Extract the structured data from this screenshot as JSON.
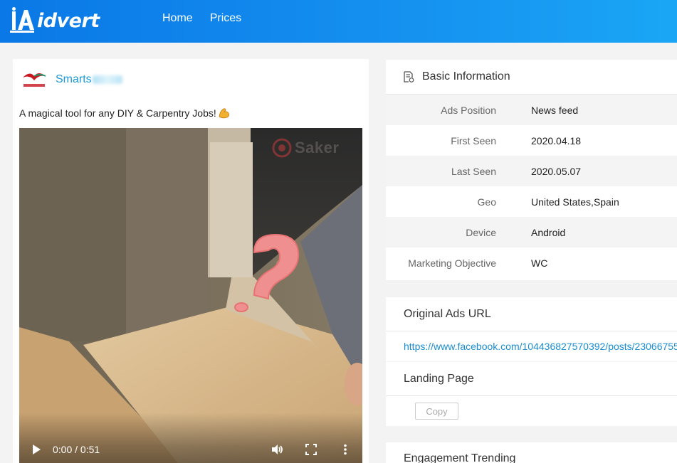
{
  "header": {
    "logo_text": "idvert",
    "nav": [
      {
        "label": "Home"
      },
      {
        "label": "Prices"
      }
    ]
  },
  "ad": {
    "advertiser_name": "Smarts",
    "text": "A magical tool for any DIY & Carpentry Jobs!",
    "watermark": "Saker",
    "video": {
      "time": "0:00 / 0:51",
      "progress": 0
    }
  },
  "basic_info": {
    "title": "Basic Information",
    "rows": [
      {
        "label": "Ads Position",
        "value": "News feed"
      },
      {
        "label": "First Seen",
        "value": "2020.04.18"
      },
      {
        "label": "Last Seen",
        "value": "2020.05.07"
      },
      {
        "label": "Geo",
        "value": "United States,Spain"
      },
      {
        "label": "Device",
        "value": "Android"
      },
      {
        "label": "Marketing Objective",
        "value": "WC"
      }
    ]
  },
  "original_url": {
    "title": "Original Ads URL",
    "url": "https://www.facebook.com/104436827570392/posts/23066755"
  },
  "landing_page": {
    "title": "Landing Page",
    "copy_label": "Copy"
  },
  "engagement": {
    "title": "Engagement Trending"
  },
  "colors": {
    "header": "#0a78e6",
    "link": "#1a9bd7",
    "accent_red": "#c8171f"
  }
}
